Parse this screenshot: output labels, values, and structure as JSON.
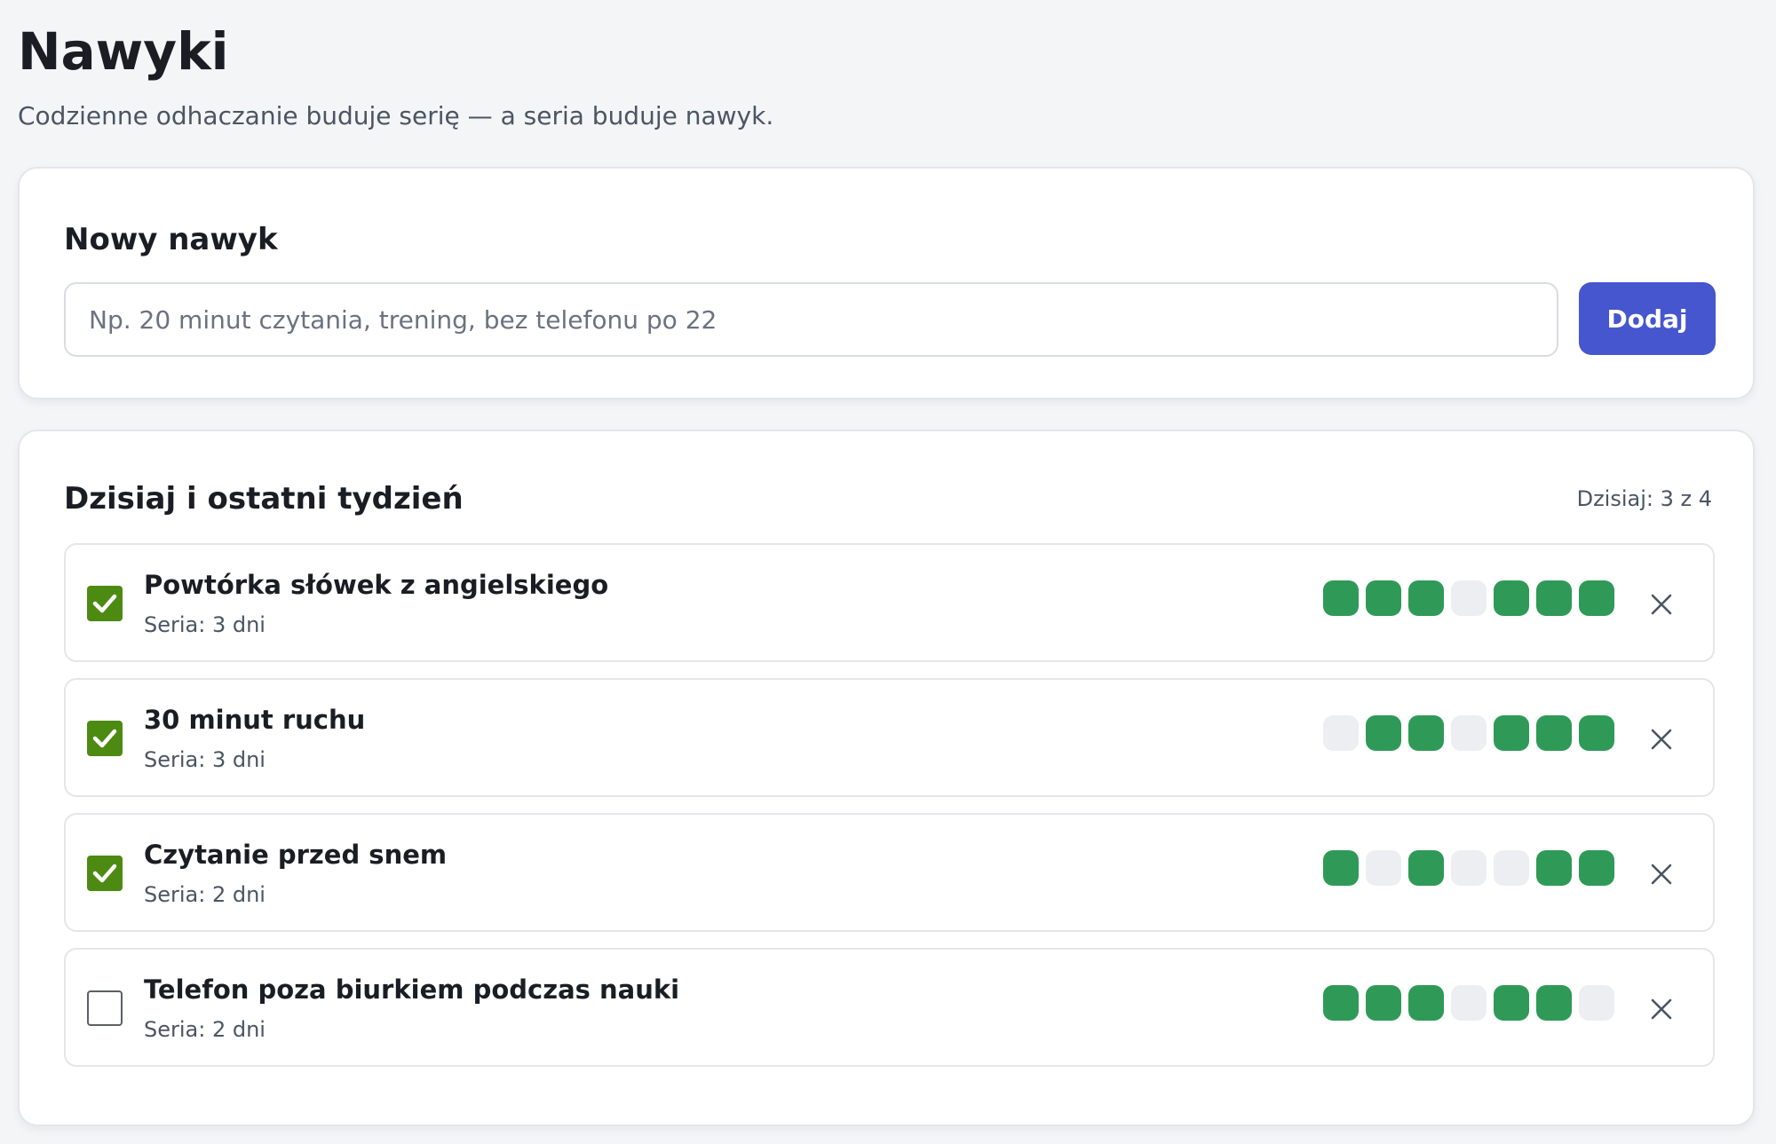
{
  "header": {
    "title": "Nawyki",
    "subtitle": "Codzienne odhaczanie buduje serię — a seria buduje nawyk."
  },
  "new_habit": {
    "heading": "Nowy nawyk",
    "placeholder": "Np. 20 minut czytania, trening, bez telefonu po 22",
    "value": "",
    "add_label": "Dodaj"
  },
  "list": {
    "heading": "Dzisiaj i ostatni tydzień",
    "today_count": "Dzisiaj: 3 z 4",
    "habits": [
      {
        "name": "Powtórka słówek z angielskiego",
        "streak": "Seria: 3 dni",
        "checked": true,
        "week": [
          1,
          1,
          1,
          0,
          1,
          1,
          1
        ]
      },
      {
        "name": "30 minut ruchu",
        "streak": "Seria: 3 dni",
        "checked": true,
        "week": [
          0,
          1,
          1,
          0,
          1,
          1,
          1
        ]
      },
      {
        "name": "Czytanie przed snem",
        "streak": "Seria: 2 dni",
        "checked": true,
        "week": [
          1,
          0,
          1,
          0,
          0,
          1,
          1
        ]
      },
      {
        "name": "Telefon poza biurkiem podczas nauki",
        "streak": "Seria: 2 dni",
        "checked": false,
        "week": [
          1,
          1,
          1,
          0,
          1,
          1,
          0
        ]
      }
    ]
  },
  "colors": {
    "accent": "#4656cf",
    "checked": "#4d8a12",
    "done_day": "#2f9a57",
    "missed_day": "#eceef1"
  }
}
